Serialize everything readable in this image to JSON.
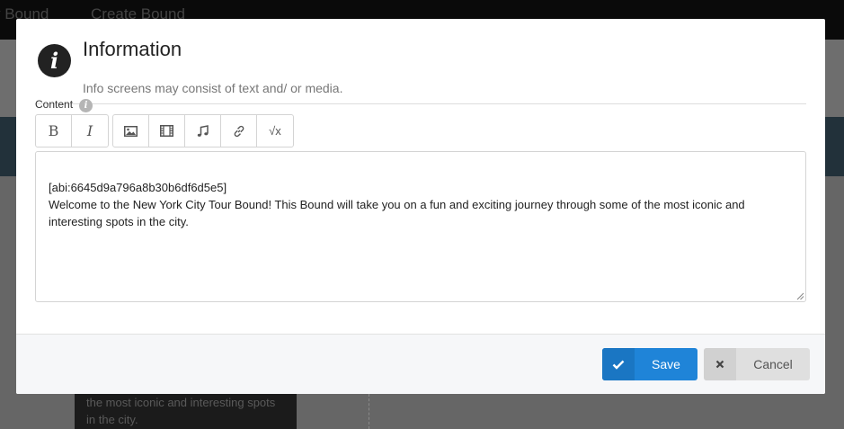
{
  "background": {
    "nav": [
      "y Bound",
      "Create Bound"
    ],
    "card_text": "the most iconic and interesting spots in the city."
  },
  "modal": {
    "title": "Information",
    "subtitle": "Info screens may consist of text and/ or media.",
    "content_label": "Content",
    "help_icon": "i",
    "info_icon": "i"
  },
  "toolbar": {
    "bold": "B",
    "italic": "I",
    "image": "image-icon",
    "video": "film-icon",
    "audio": "music-icon",
    "link": "link-icon",
    "formula": "√x"
  },
  "editor": {
    "line1": "[abi:6645d9a796a8b30b6df6d5e5]",
    "line2": "Welcome to the New York City Tour Bound! This Bound will take you on a fun and exciting journey through some of the most iconic and interesting spots in the city."
  },
  "footer": {
    "save_label": "Save",
    "cancel_label": "Cancel"
  },
  "colors": {
    "primary": "#1f84d8",
    "overlay": "#6b6b6b"
  }
}
